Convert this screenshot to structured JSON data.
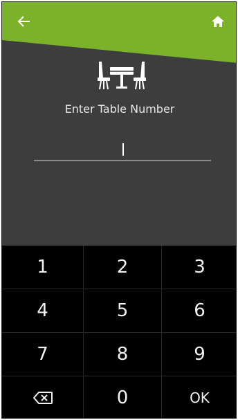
{
  "header": {
    "accent_color": "#7bb22a",
    "back_icon": "arrow-left-icon",
    "home_icon": "home-icon"
  },
  "content": {
    "illustration_icon": "dining-table-icon",
    "prompt": "Enter Table Number",
    "entry_value": ""
  },
  "keypad": {
    "keys": [
      "1",
      "2",
      "3",
      "4",
      "5",
      "6",
      "7",
      "8",
      "9",
      "",
      "0",
      "OK"
    ],
    "backspace_icon": "backspace-icon"
  },
  "colors": {
    "background": "#3d3d3d",
    "keypad_background": "#000000",
    "text": "#e8e8e8"
  }
}
